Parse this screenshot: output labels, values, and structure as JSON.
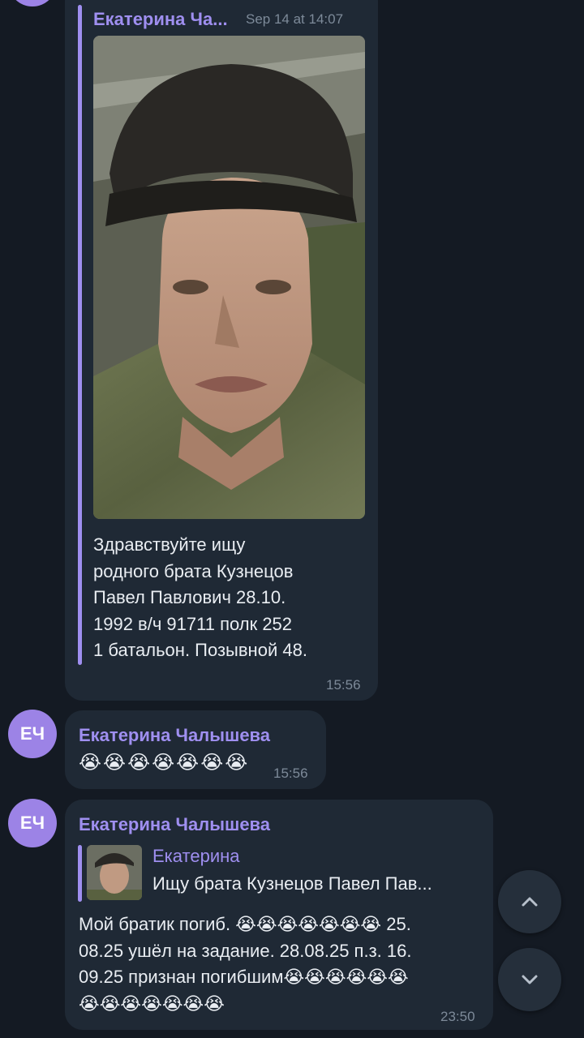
{
  "message1": {
    "forward_from": "Екатерина Ча...",
    "forward_date": "Sep 14 at 14:07",
    "text_lines": [
      "Здравствуйте ищу",
      "родного брата Кузнецов",
      "Павел Павлович 28.10.",
      "1992  в/ч 91711 полк 252",
      "1 батальон. Позывной 48."
    ],
    "time": "15:56"
  },
  "message2": {
    "avatar_initials": "ЕЧ",
    "sender": "Екатерина Чалышева",
    "emojis": "😭😭😭😭😭😭😭",
    "time": "15:56"
  },
  "message3": {
    "avatar_initials": "ЕЧ",
    "sender": "Екатерина Чалышева",
    "reply_name": "Екатерина",
    "reply_text": "Ищу брата Кузнецов Павел Пав...",
    "text_lines": [
      "Мой братик погиб. 😭😭😭😭😭😭😭 25.",
      "08.25 ушёл на задание. 28.08.25 п.з. 16.",
      "09.25 признан погибшим😭😭😭😭😭😭",
      "😭😭😭😭😭😭😭"
    ],
    "time": "23:50"
  },
  "scroll_buttons": {
    "up_icon": "chevron-up-icon",
    "down_icon": "chevron-down-icon"
  },
  "colors": {
    "background": "#141a23",
    "bubble": "#1f2935",
    "accent": "#9f8ff0",
    "avatar": "#9c83e6"
  }
}
